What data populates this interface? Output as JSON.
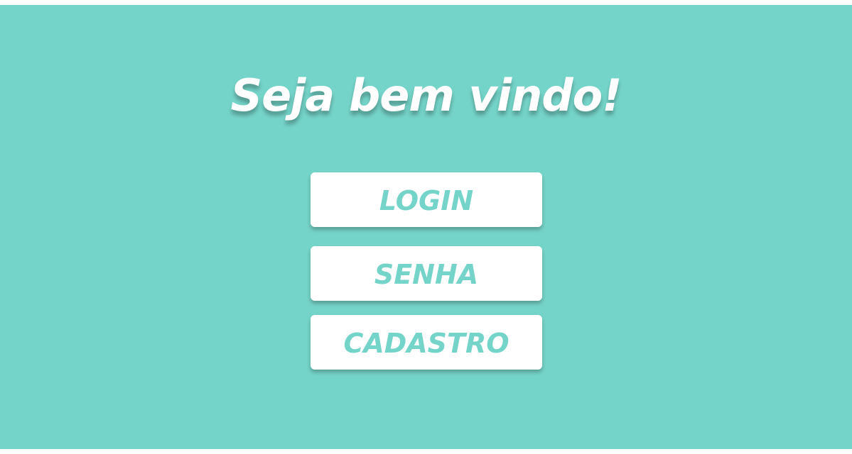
{
  "colors": {
    "background": "#75d4c9",
    "button_background": "#ffffff",
    "button_text": "#75d4c9",
    "title_text": "#ffffff"
  },
  "header": {
    "title": "Seja bem vindo!"
  },
  "menu": {
    "login_label": "LOGIN",
    "senha_label": "SENHA",
    "cadastro_label": "CADASTRO"
  }
}
